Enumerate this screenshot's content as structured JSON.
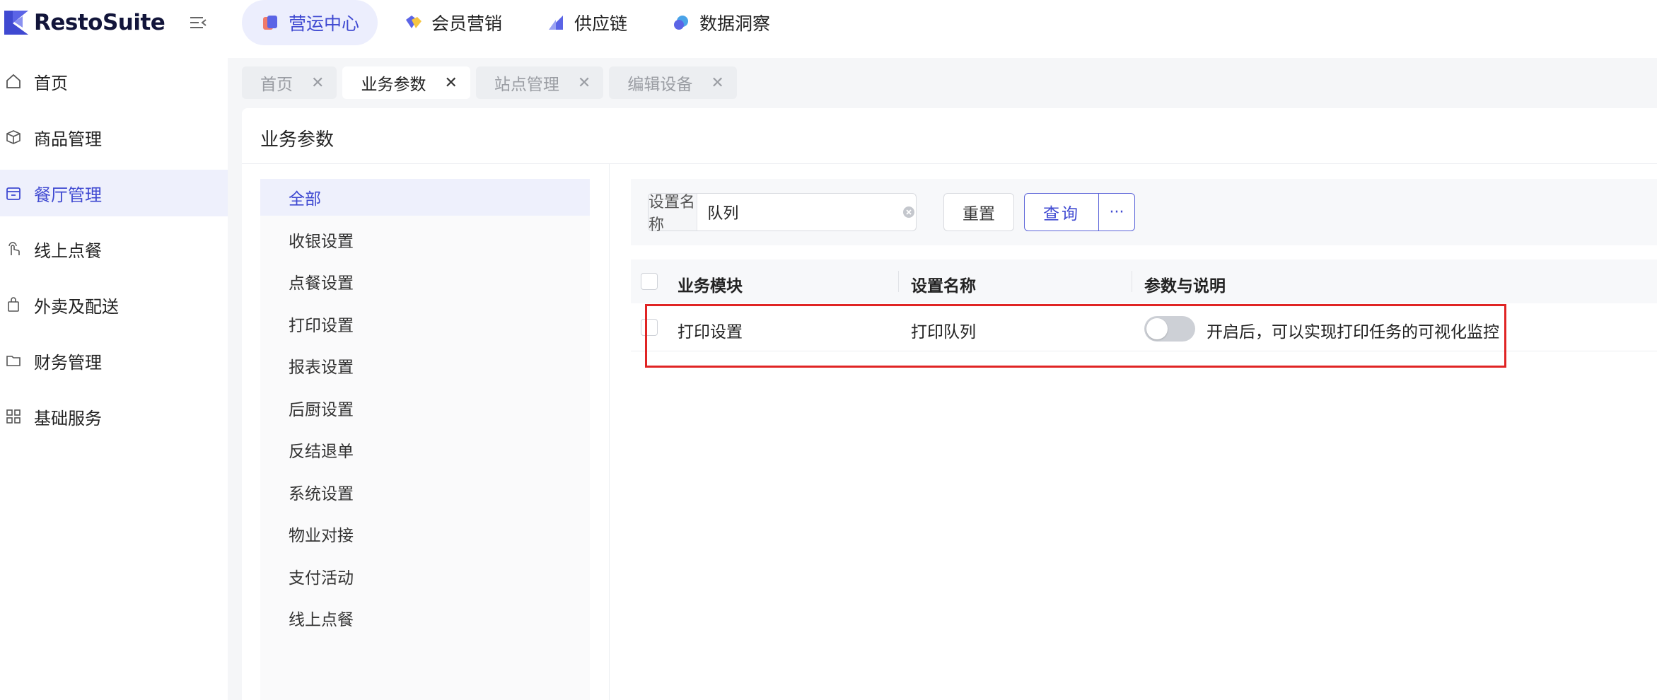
{
  "app": {
    "name": "RestoSuite"
  },
  "colors": {
    "accent": "#3f49d1",
    "highlight": "#e02424"
  },
  "topbar": {
    "collapse_icon": "menu-collapse-icon",
    "modules": [
      {
        "label": "营运中心",
        "icon": "operations-icon",
        "active": true
      },
      {
        "label": "会员营销",
        "icon": "membership-icon",
        "active": false
      },
      {
        "label": "供应链",
        "icon": "supply-chain-icon",
        "active": false
      },
      {
        "label": "数据洞察",
        "icon": "insights-icon",
        "active": false
      }
    ]
  },
  "sidebar": {
    "items": [
      {
        "label": "首页",
        "icon": "home-icon",
        "active": false
      },
      {
        "label": "商品管理",
        "icon": "box-icon",
        "active": false
      },
      {
        "label": "餐厅管理",
        "icon": "store-icon",
        "active": true
      },
      {
        "label": "线上点餐",
        "icon": "hand-tap-icon",
        "active": false
      },
      {
        "label": "外卖及配送",
        "icon": "bag-icon",
        "active": false
      },
      {
        "label": "财务管理",
        "icon": "folder-icon",
        "active": false
      },
      {
        "label": "基础服务",
        "icon": "grid-icon",
        "active": false
      }
    ]
  },
  "page_tabs": [
    {
      "label": "首页",
      "active": false
    },
    {
      "label": "业务参数",
      "active": true
    },
    {
      "label": "站点管理",
      "active": false
    },
    {
      "label": "编辑设备",
      "active": false
    }
  ],
  "page": {
    "title": "业务参数",
    "categories": [
      "全部",
      "收银设置",
      "点餐设置",
      "打印设置",
      "报表设置",
      "后厨设置",
      "反结退单",
      "系统设置",
      "物业对接",
      "支付活动",
      "线上点餐"
    ],
    "active_category": "全部",
    "filter": {
      "label": "设置名称",
      "value": "队列",
      "reset_label": "重置",
      "query_label": "查询",
      "more_label": "···"
    },
    "table": {
      "columns": [
        "业务模块",
        "设置名称",
        "参数与说明"
      ],
      "rows": [
        {
          "module": "打印设置",
          "name": "打印队列",
          "enabled": false,
          "description": "开启后，可以实现打印任务的可视化监控"
        }
      ]
    }
  }
}
